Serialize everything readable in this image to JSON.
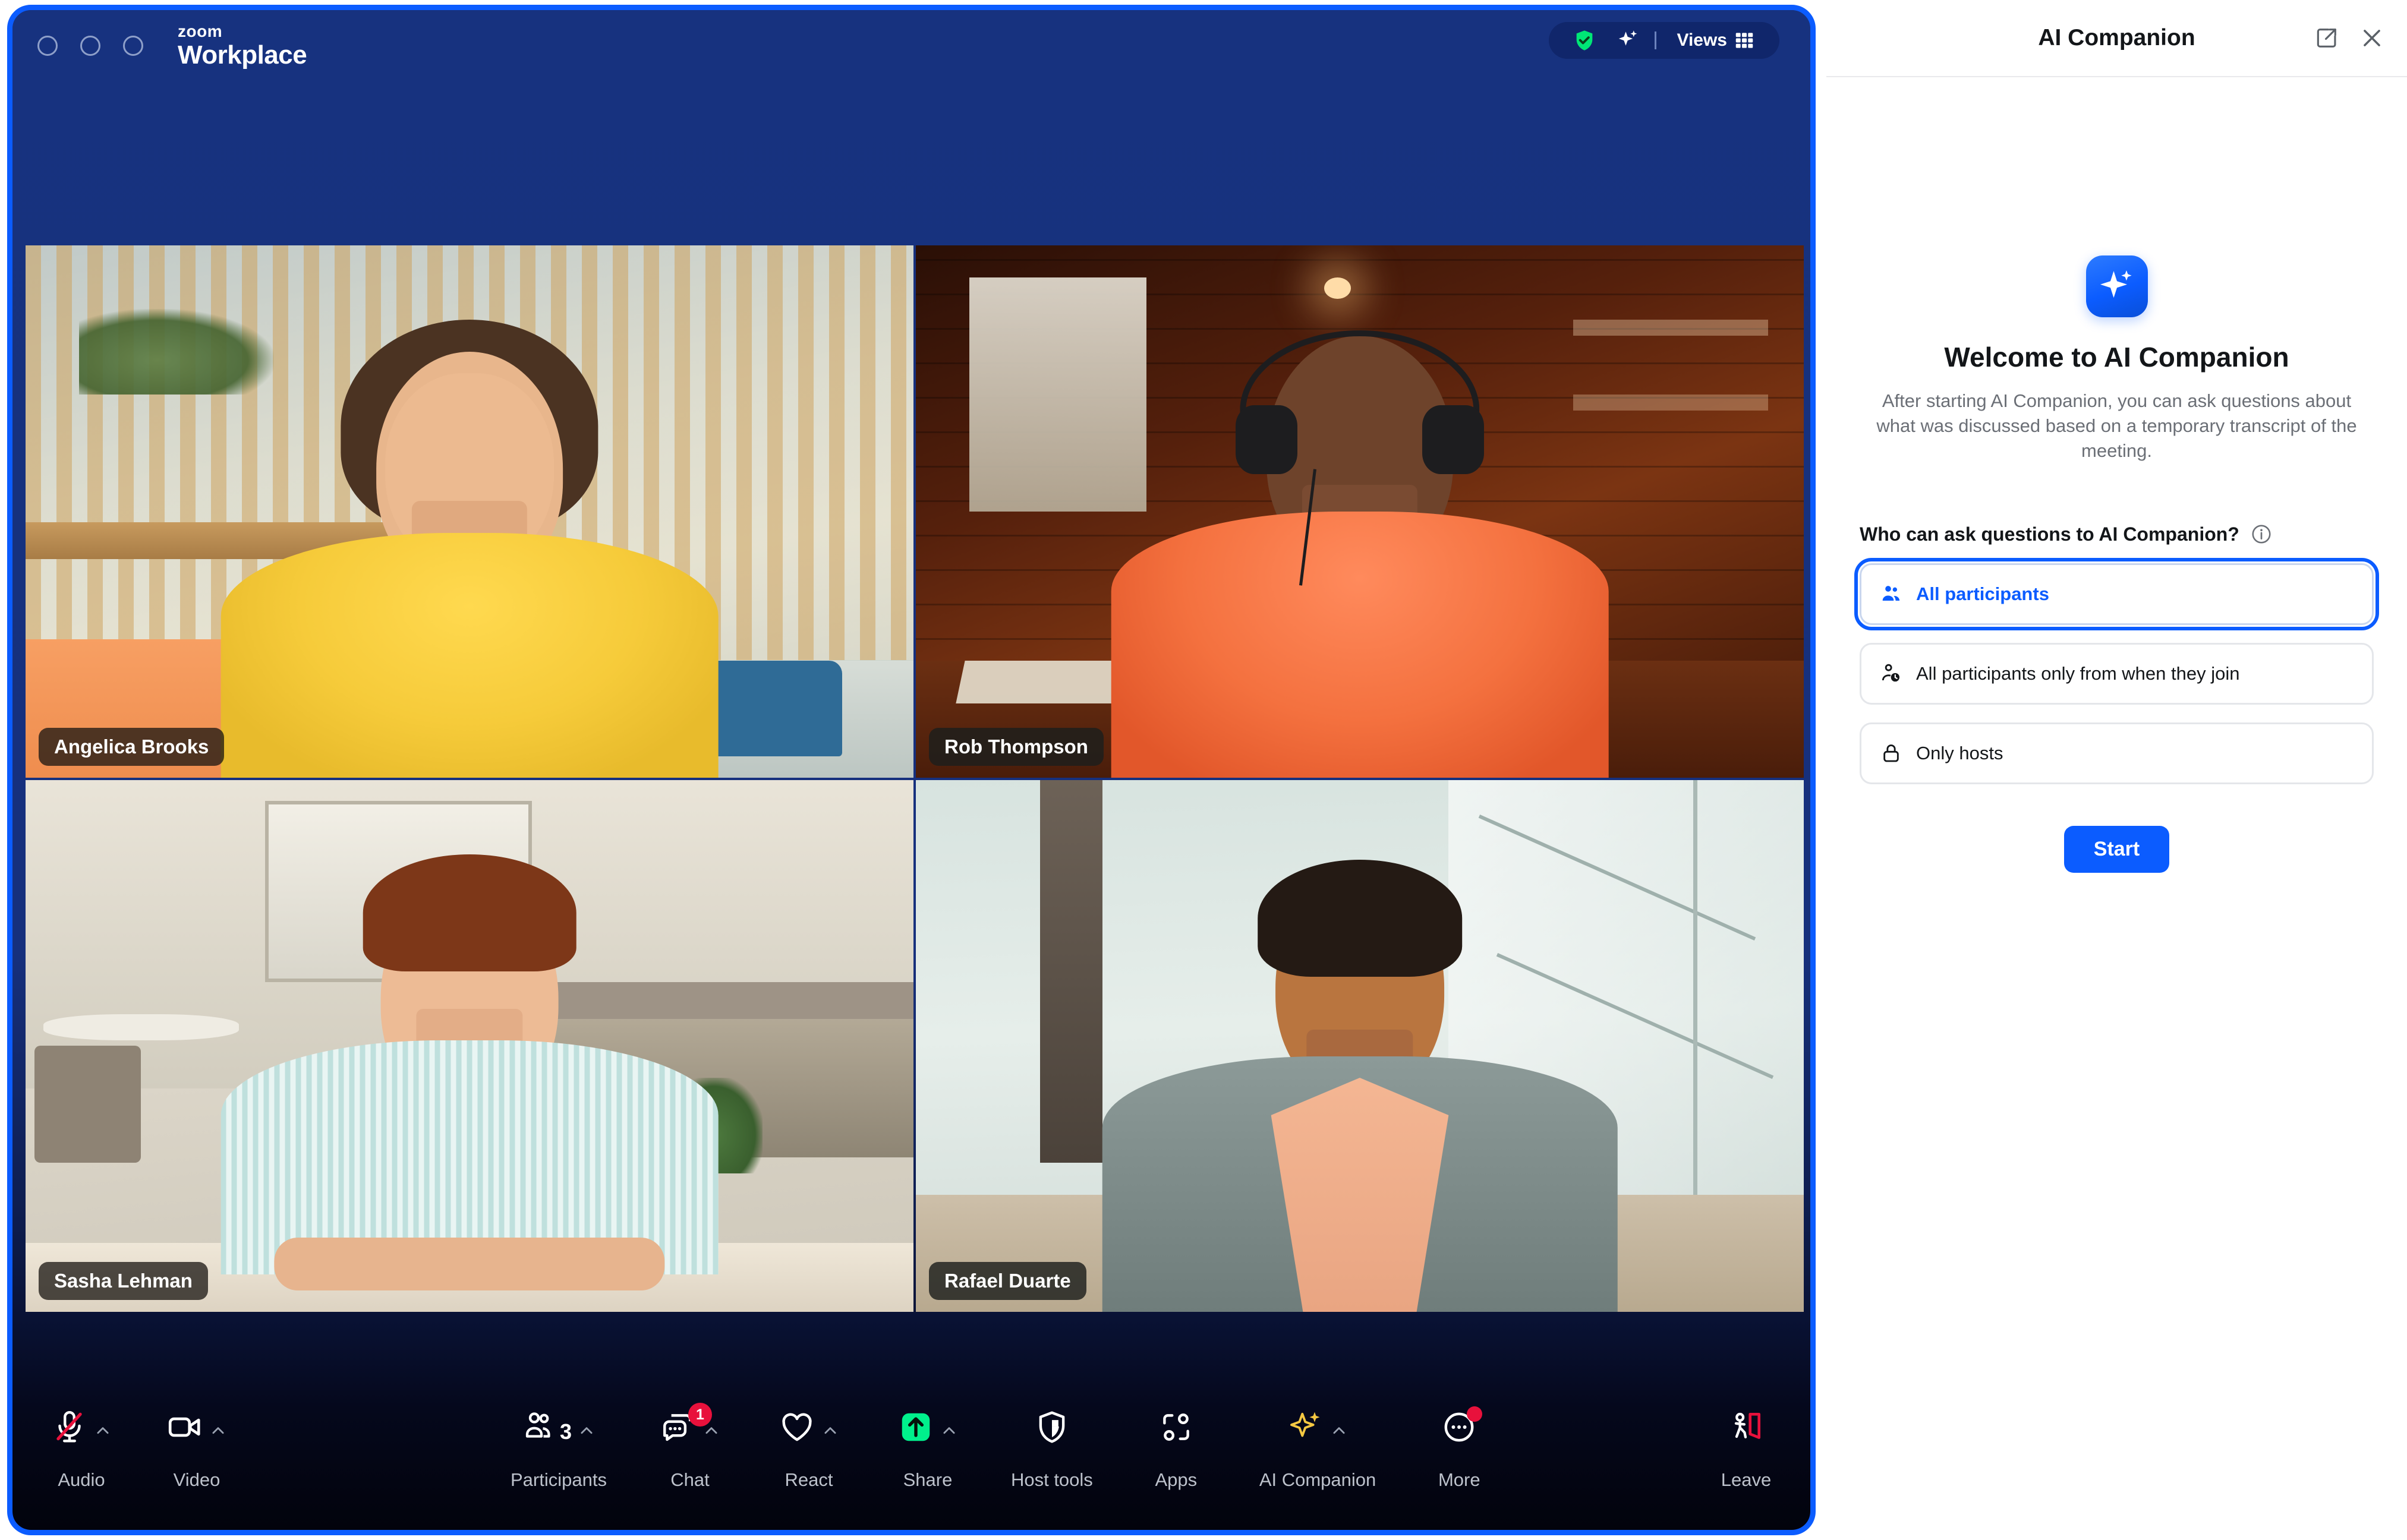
{
  "app": {
    "brand_top": "zoom",
    "brand_bottom": "Workplace",
    "window_controls": [
      "close",
      "minimize",
      "maximize"
    ]
  },
  "status_pill": {
    "security_icon": "shield-check-icon",
    "ai_icon": "sparkle-icon",
    "views_label": "Views",
    "grid_icon": "grid-icon"
  },
  "video_grid": {
    "participants": [
      {
        "name": "Angelica Brooks"
      },
      {
        "name": "Rob Thompson"
      },
      {
        "name": "Sasha Lehman"
      },
      {
        "name": "Rafael Duarte"
      }
    ]
  },
  "toolbar": {
    "items": [
      {
        "label": "Audio",
        "icon": "mic-muted-icon",
        "caret": true,
        "badge": null,
        "count": null
      },
      {
        "label": "Video",
        "icon": "camera-icon",
        "caret": true,
        "badge": null,
        "count": null
      },
      {
        "label": "Participants",
        "icon": "participants-icon",
        "caret": true,
        "badge": null,
        "count": "3"
      },
      {
        "label": "Chat",
        "icon": "chat-icon",
        "caret": true,
        "badge": "1",
        "count": null
      },
      {
        "label": "React",
        "icon": "heart-icon",
        "caret": true,
        "badge": null,
        "count": null
      },
      {
        "label": "Share",
        "icon": "share-screen-icon",
        "caret": true,
        "badge": null,
        "count": null
      },
      {
        "label": "Host tools",
        "icon": "shield-icon",
        "caret": false,
        "badge": null,
        "count": null
      },
      {
        "label": "Apps",
        "icon": "apps-icon",
        "caret": false,
        "badge": null,
        "count": null
      },
      {
        "label": "AI Companion",
        "icon": "sparkle-gold-icon",
        "caret": true,
        "badge": null,
        "count": null
      },
      {
        "label": "More",
        "icon": "more-dots-icon",
        "caret": false,
        "badge": "dot",
        "count": null
      },
      {
        "label": "Leave",
        "icon": "leave-door-icon",
        "caret": false,
        "badge": null,
        "count": null
      }
    ]
  },
  "ai_panel": {
    "title": "AI Companion",
    "popout_icon": "pop-out-icon",
    "close_icon": "close-icon",
    "logo_icon": "ai-sparkle-icon",
    "welcome_title": "Welcome to AI Companion",
    "welcome_desc": "After starting AI Companion, you can ask questions about what was discussed based on a temporary transcript of the meeting.",
    "permission_question": "Who can ask questions to AI Companion?",
    "info_icon": "info-icon",
    "options": [
      {
        "label": "All participants",
        "icon": "people-icon",
        "selected": true
      },
      {
        "label": "All participants only from when they join",
        "icon": "person-clock-icon",
        "selected": false
      },
      {
        "label": "Only hosts",
        "icon": "lock-icon",
        "selected": false
      }
    ],
    "start_label": "Start"
  },
  "colors": {
    "brand_blue": "#0B5CFF",
    "meeting_bg": "#16307d",
    "share_green": "#00F08C",
    "badge_red": "#E8113C",
    "leave_red": "#E8113C",
    "ai_gold": "#F5C842"
  }
}
